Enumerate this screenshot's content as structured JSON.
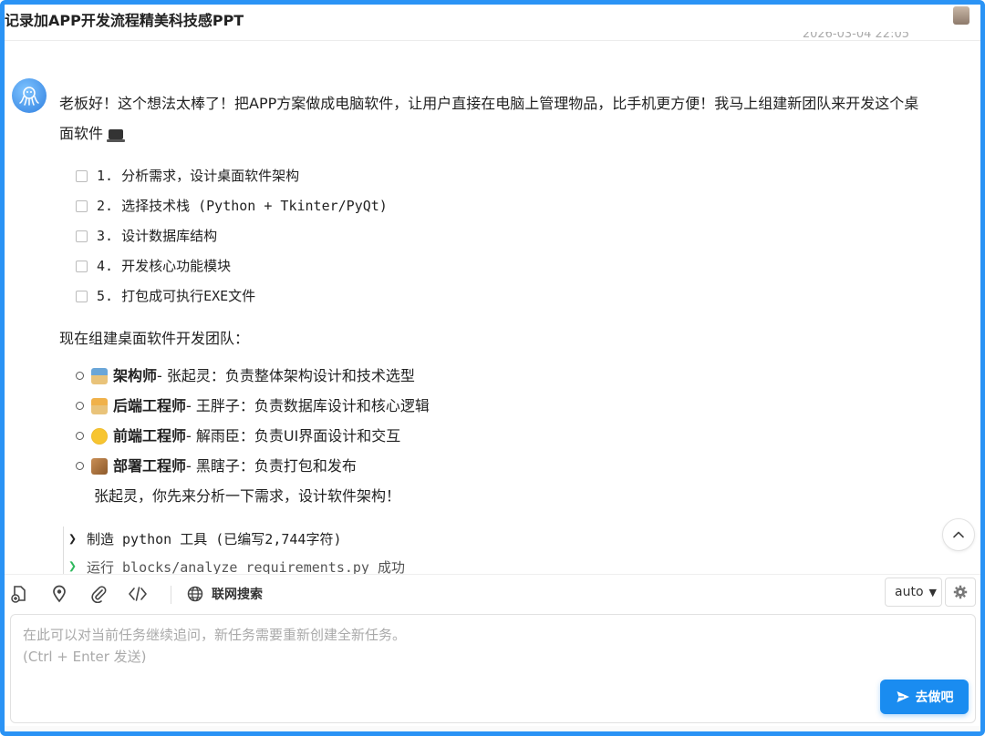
{
  "window": {
    "title": "记录加APP开发流程精美科技感PPT",
    "timestamp": "2026-03-04 22:05"
  },
  "message": {
    "intro": "老板好！这个想法太棒了！把APP方案做成电脑软件，让用户直接在电脑上管理物品，比手机更方便！我马上组建新团队来开发这个桌面软件",
    "tasks": [
      "1. 分析需求，设计桌面软件架构",
      "2. 选择技术栈 (Python + Tkinter/PyQt)",
      "3. 设计数据库结构",
      "4. 开发核心功能模块",
      "5. 打包成可执行EXE文件"
    ],
    "team_title": "现在组建桌面软件开发团队：",
    "team": [
      {
        "role": "架构师",
        "detail": " - 张起灵：负责整体架构设计和技术选型"
      },
      {
        "role": "后端工程师",
        "detail": " - 王胖子：负责数据库设计和核心逻辑"
      },
      {
        "role": "前端工程师",
        "detail": " - 解雨臣：负责UI界面设计和交互"
      },
      {
        "role": "部署工程师",
        "detail": " - 黑瞎子：负责打包和发布"
      }
    ],
    "closing": "张起灵，你先来分析一下需求，设计软件架构！",
    "tool_calls": [
      "制造 python 工具 (已编写2,744字符)",
      "运行 blocks/analyze_requirements.py 成功"
    ]
  },
  "toolbar": {
    "web_search_label": "联网搜索",
    "model_value": "auto"
  },
  "input": {
    "placeholder_line1": "在此可以对当前任务继续追问，新任务需要重新创建全新任务。",
    "placeholder_line2": "(Ctrl + Enter 发送)",
    "send_label": "去做吧"
  },
  "colors": {
    "accent": "#1a8cf0",
    "frame": "#2a93f5",
    "success": "#2eb85c"
  }
}
